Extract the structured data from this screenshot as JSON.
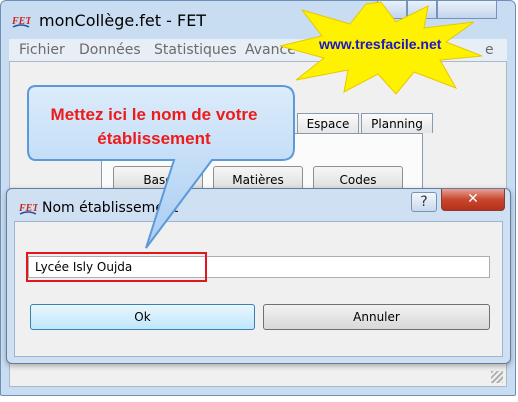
{
  "main_window": {
    "title": "monCollège.fet - FET",
    "menu": [
      "Fichier",
      "Données",
      "Statistiques",
      "Avance",
      "e"
    ],
    "tabs": [
      "Espace",
      "Planning"
    ],
    "buttons": [
      "Base",
      "Matières",
      "Codes"
    ],
    "icon": "fet-logo-icon"
  },
  "banner": {
    "text": "www.tresfacile.net",
    "color": "#1a17c9"
  },
  "callout": {
    "line1": "Mettez ici le nom de votre",
    "line2": "établissement",
    "color": "#ee1b1b"
  },
  "dialog": {
    "title": "Nom établissement",
    "help_label": "?",
    "close_label": "✕",
    "input_value": "Lycée Isly Oujda",
    "ok_label": "Ok",
    "cancel_label": "Annuler"
  },
  "icons": {
    "app": "fet-logo-icon",
    "help": "help-icon",
    "close": "close-icon",
    "grip": "resize-grip-icon"
  },
  "colors": {
    "title_bar": "#c9ddf2",
    "highlight": "#e2161c",
    "burst_fill": "#fff200"
  }
}
